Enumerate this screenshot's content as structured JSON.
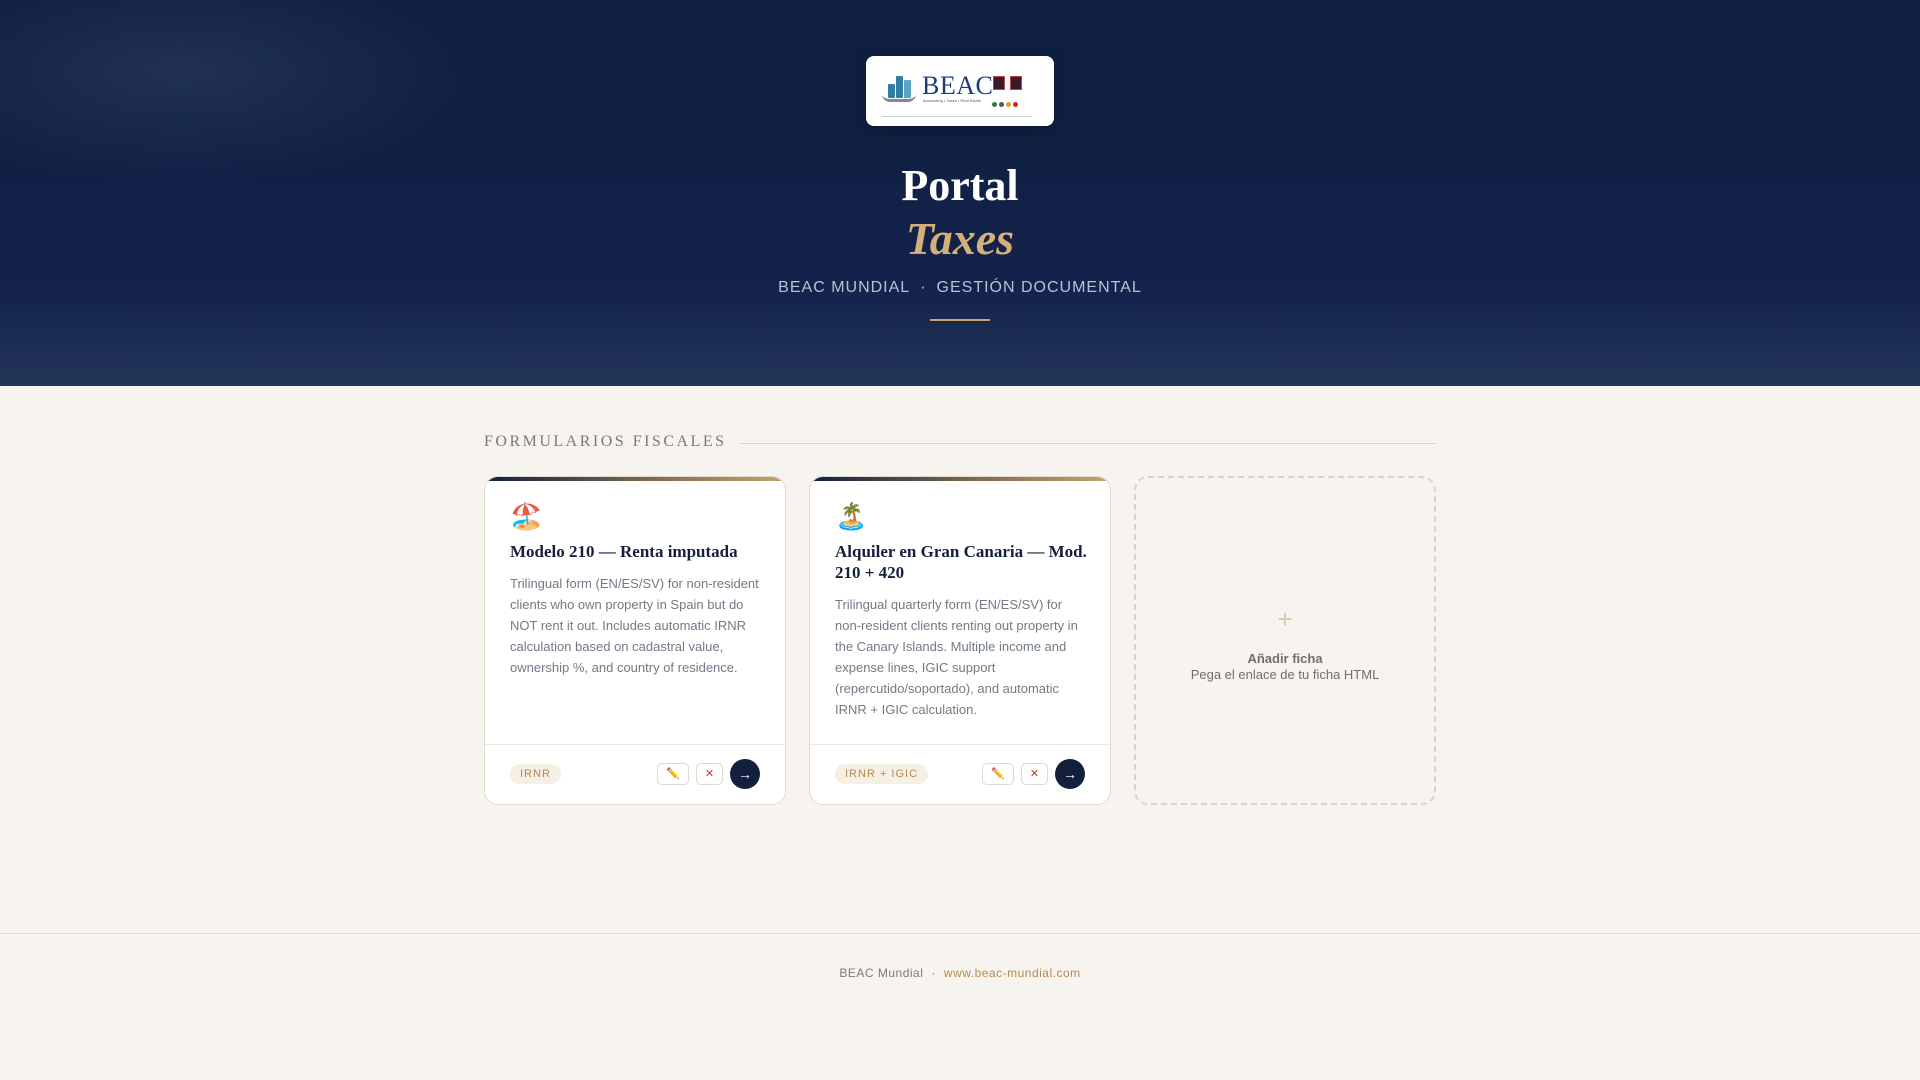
{
  "colors": {
    "hero_background": "#0f1f3f",
    "accent_gold": "#c9a36b",
    "page_background": "#f7f4ef",
    "card_title": "#13203d",
    "delete_red": "#c0392b"
  },
  "header": {
    "logo": {
      "wordmark": "BEAC",
      "tagline": "Accounting • Taxes • Real Estate"
    },
    "title": "Portal",
    "subtitle": "Taxes",
    "tagline_left": "BEAC MUNDIAL",
    "tagline_sep": "·",
    "tagline_right": "GESTIÓN DOCUMENTAL"
  },
  "section": {
    "title": "FORMULARIOS FISCALES"
  },
  "cards": [
    {
      "icon": "beach-umbrella-icon",
      "emoji": "🏖️",
      "title": "Modelo 210 — Renta imputada",
      "description": "Trilingual form (EN/ES/SV) for non-resident clients who own property in Spain but do NOT rent it out. Includes automatic IRNR calculation based on cadastral value, ownership %, and country of residence.",
      "tag": "IRNR",
      "edit_label": "✏️",
      "delete_label": "✕",
      "open_label": "→"
    },
    {
      "icon": "palm-island-icon",
      "emoji": "🏝️",
      "title": "Alquiler en Gran Canaria — Mod. 210 + 420",
      "description": "Trilingual quarterly form (EN/ES/SV) for non-resident clients renting out property in the Canary Islands. Multiple income and expense lines, IGIC support (repercutido/soportado), and automatic IRNR + IGIC calculation.",
      "tag": "IRNR + IGIC",
      "edit_label": "✏️",
      "delete_label": "✕",
      "open_label": "→"
    }
  ],
  "add_card": {
    "plus": "+",
    "title": "Añadir ficha",
    "subtitle": "Pega el enlace de tu ficha HTML"
  },
  "footer": {
    "company": "BEAC Mundial",
    "separator": "·",
    "website": "www.beac-mundial.com"
  }
}
